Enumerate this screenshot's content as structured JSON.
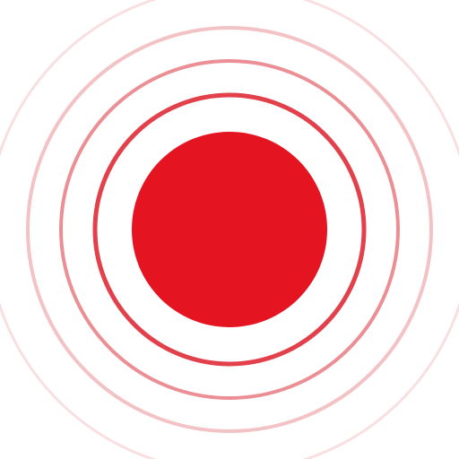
{
  "icon": {
    "name": "recording-pulse-icon",
    "colors": {
      "background": "#ffffff",
      "dot": "#e51421",
      "ring_inner": "#e2404b",
      "ring_2": "#e6636b",
      "ring_3": "#ec8f95",
      "ring_4": "#f3c2c5",
      "ring_outer": "#f8dfe1"
    }
  }
}
